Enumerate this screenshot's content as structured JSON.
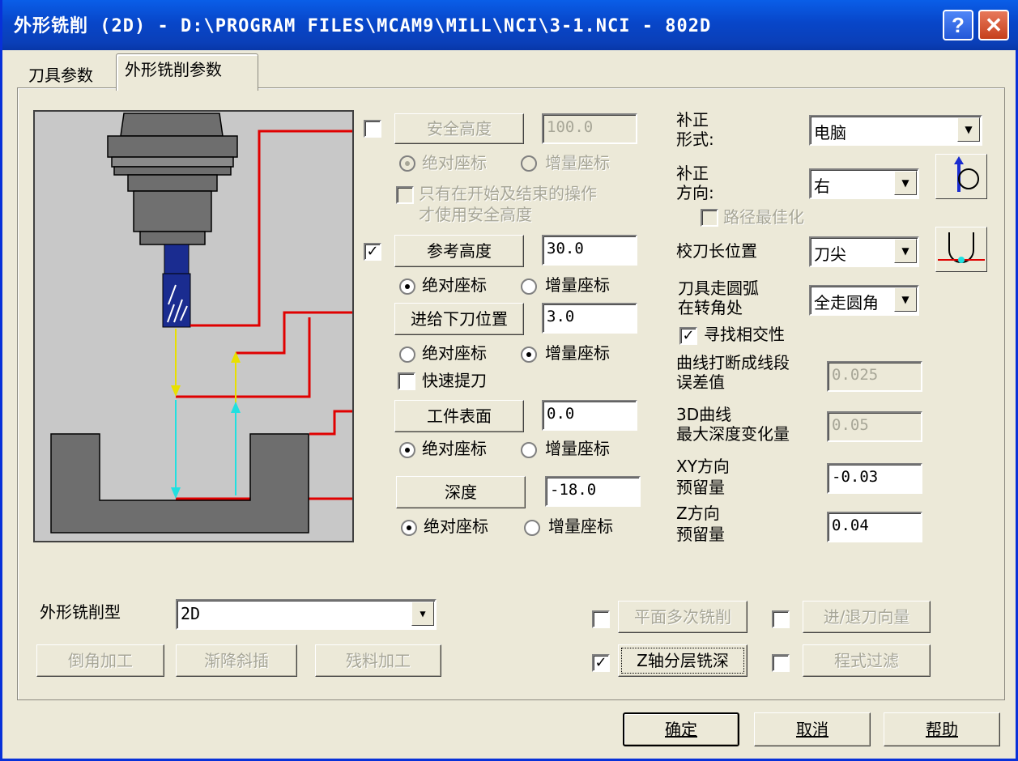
{
  "window": {
    "title": "外形铣削  (2D) - D:\\PROGRAM FILES\\MCAM9\\MILL\\NCI\\3-1.NCI - 802D"
  },
  "titlebar": {
    "help_label": "?",
    "close_label": "✕"
  },
  "tabs": [
    {
      "label": "刀具参数"
    },
    {
      "label": "外形铣削参数"
    }
  ],
  "heights": {
    "safety": {
      "button": "安全高度",
      "value": "100.0",
      "checked": false,
      "abs": "绝对座标",
      "inc": "增量座标",
      "only_label": "只有在开始及结束的操作",
      "only_label2": "才使用安全高度"
    },
    "reference": {
      "button": "参考高度",
      "value": "30.0",
      "checked": true,
      "abs": "绝对座标",
      "inc": "增量座标"
    },
    "feed": {
      "button": "进给下刀位置",
      "value": "3.0",
      "abs": "绝对座标",
      "inc": "增量座标",
      "rapid": "快速提刀"
    },
    "top": {
      "button": "工件表面",
      "value": "0.0",
      "abs": "绝对座标",
      "inc": "增量座标"
    },
    "depth": {
      "button": "深度",
      "value": "-18.0",
      "abs": "绝对座标",
      "inc": "增量座标"
    }
  },
  "comp": {
    "type_label1": "补正",
    "type_label2": "形式:",
    "type_value": "电脑",
    "dir_label1": "补正",
    "dir_label2": "方向:",
    "dir_value": "右",
    "optimize": "路径最佳化",
    "tip_label": "校刀长位置",
    "tip_value": "刀尖",
    "roll_label1": "刀具走圆弧",
    "roll_label2": "在转角处",
    "roll_value": "全走圆角",
    "intersect": "寻找相交性",
    "tol_label1": "曲线打断成线段",
    "tol_label2": "误差值",
    "tol_value": "0.025",
    "depth3d_label1": "3D曲线",
    "depth3d_label2": "最大深度变化量",
    "depth3d_value": "0.05",
    "xy_label1": "XY方向",
    "xy_label2": "预留量",
    "xy_value": "-0.03",
    "z_label1": "Z方向",
    "z_label2": "预留量",
    "z_value": "0.04"
  },
  "contour": {
    "type_label": "外形铣削型",
    "type_value": "2D"
  },
  "bottom_buttons": {
    "chamfer": "倒角加工",
    "ramp": "渐降斜插",
    "remach": "残料加工",
    "multipass": "平面多次铣削",
    "leadio": "进/退刀向量",
    "depthcuts": "Z轴分层铣深",
    "filter": "程式过滤"
  },
  "dialog_buttons": {
    "ok": "确定",
    "cancel": "取消",
    "help": "帮助"
  },
  "colors": {
    "title_bar": "#0846c9",
    "path_red": "#e00000",
    "arrow_yellow": "#e8e000",
    "arrow_cyan": "#20e0e0",
    "tool_blue": "#1a2c90"
  }
}
